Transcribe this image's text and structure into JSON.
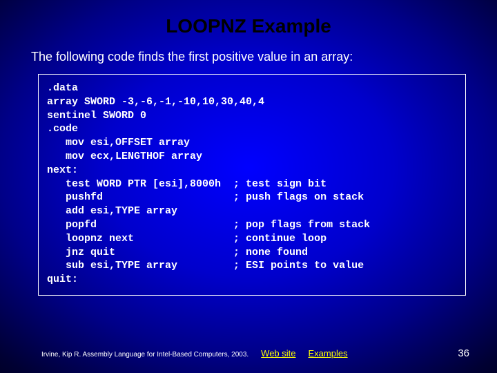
{
  "title": "LOOPNZ Example",
  "intro": "The following code finds the first positive value in an array:",
  "code": ".data\narray SWORD -3,-6,-1,-10,10,30,40,4\nsentinel SWORD 0\n.code\n   mov esi,OFFSET array\n   mov ecx,LENGTHOF array\nnext:\n   test WORD PTR [esi],8000h  ; test sign bit\n   pushfd                     ; push flags on stack\n   add esi,TYPE array\n   popfd                      ; pop flags from stack\n   loopnz next                ; continue loop\n   jnz quit                   ; none found\n   sub esi,TYPE array         ; ESI points to value\nquit:",
  "footer": {
    "credit": "Irvine, Kip R. Assembly Language for Intel-Based Computers, 2003.",
    "link_web": "Web site",
    "link_examples": "Examples",
    "page": "36"
  }
}
